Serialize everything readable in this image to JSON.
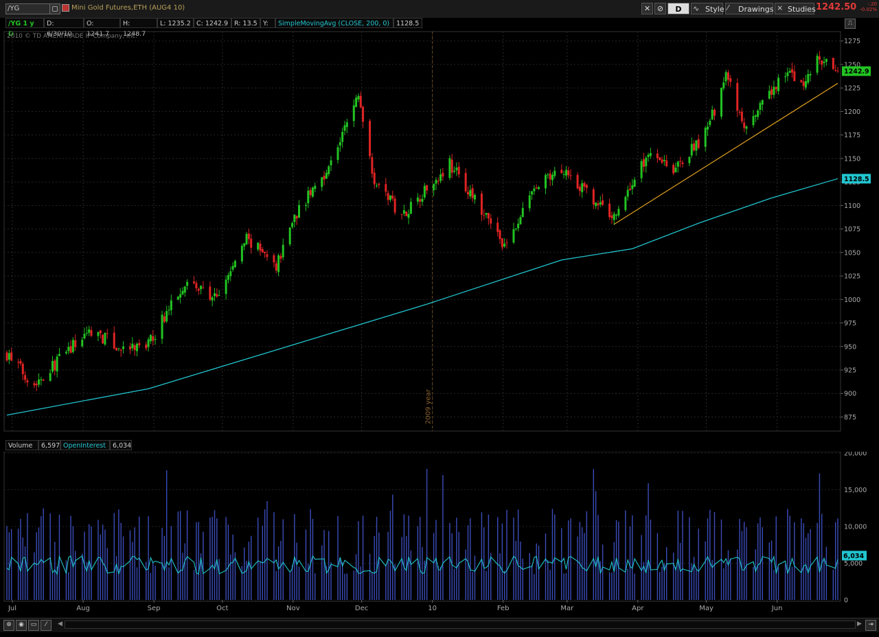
{
  "toolbar": {
    "symbol": "/YG",
    "description": "Mini Gold Futures,ETH (AUG4 10)",
    "timeframe_button": "D",
    "style_label": "Style",
    "drawings_label": "Drawings",
    "studies_label": "Studies",
    "last_price": "1242.50",
    "change": "-.20",
    "change_pct": "-0.02%"
  },
  "infobar": {
    "symbol_period": "/YG 1 y D",
    "date": "D: 6/30/10",
    "open": "O: 1241.7",
    "high": "H: 1248.7",
    "low": "L: 1235.2",
    "close": "C: 1242.9",
    "range": "R: 13.5",
    "y": "Y:",
    "study": "SimpleMovingAvg (CLOSE, 200, 0)",
    "study_value": "1128.5"
  },
  "copyright": "2010 © TD AMERITRADE IP Company, Inc.",
  "volume_bar": {
    "volume_label": "Volume",
    "volume_value": "6,597",
    "oi_label": "OpenInterest",
    "oi_value": "6,034"
  },
  "colors": {
    "up": "#22c322",
    "down": "#e02424",
    "sma": "#21c5cf",
    "trendline": "#e0a020",
    "volume": "#3b4dbb",
    "oi": "#21c5cf"
  },
  "chart_data": {
    "type": "candlestick",
    "x_range": [
      "2009-07-01",
      "2010-06-30"
    ],
    "x_ticks": [
      "Jul",
      "Aug",
      "Sep",
      "Oct",
      "Nov",
      "Dec",
      "10",
      "Feb",
      "Mar",
      "Apr",
      "May",
      "Jun"
    ],
    "year_marker": "2009 year",
    "ylim": [
      860,
      1285
    ],
    "y_ticks": [
      875,
      900,
      925,
      950,
      975,
      1000,
      1025,
      1050,
      1075,
      1100,
      1125,
      1150,
      1175,
      1200,
      1225,
      1250,
      1275
    ],
    "last_close": 1242.9,
    "sma_last": 1128.5,
    "price_path": [
      {
        "date": "2009-07-01",
        "close": 942
      },
      {
        "date": "2009-07-13",
        "close": 910
      },
      {
        "date": "2009-07-31",
        "close": 953
      },
      {
        "date": "2009-08-07",
        "close": 968
      },
      {
        "date": "2009-08-21",
        "close": 945
      },
      {
        "date": "2009-09-01",
        "close": 952
      },
      {
        "date": "2009-09-17",
        "close": 1020
      },
      {
        "date": "2009-10-01",
        "close": 1000
      },
      {
        "date": "2009-10-14",
        "close": 1065
      },
      {
        "date": "2009-10-27",
        "close": 1035
      },
      {
        "date": "2009-11-03",
        "close": 1085
      },
      {
        "date": "2009-11-20",
        "close": 1145
      },
      {
        "date": "2009-12-02",
        "close": 1218
      },
      {
        "date": "2009-12-09",
        "close": 1128
      },
      {
        "date": "2009-12-21",
        "close": 1090
      },
      {
        "date": "2010-01-11",
        "close": 1145
      },
      {
        "date": "2010-01-28",
        "close": 1083
      },
      {
        "date": "2010-02-05",
        "close": 1055
      },
      {
        "date": "2010-02-16",
        "close": 1115
      },
      {
        "date": "2010-03-02",
        "close": 1140
      },
      {
        "date": "2010-03-15",
        "close": 1105
      },
      {
        "date": "2010-03-24",
        "close": 1088
      },
      {
        "date": "2010-04-09",
        "close": 1160
      },
      {
        "date": "2010-04-20",
        "close": 1138
      },
      {
        "date": "2010-05-04",
        "close": 1180
      },
      {
        "date": "2010-05-12",
        "close": 1240
      },
      {
        "date": "2010-05-20",
        "close": 1180
      },
      {
        "date": "2010-06-01",
        "close": 1220
      },
      {
        "date": "2010-06-08",
        "close": 1245
      },
      {
        "date": "2010-06-14",
        "close": 1225
      },
      {
        "date": "2010-06-21",
        "close": 1255
      },
      {
        "date": "2010-06-30",
        "close": 1242.9
      }
    ],
    "sma_200": [
      {
        "date": "2009-07-01",
        "value": 877
      },
      {
        "date": "2009-09-01",
        "value": 905
      },
      {
        "date": "2009-11-01",
        "value": 950
      },
      {
        "date": "2010-01-01",
        "value": 995
      },
      {
        "date": "2010-03-01",
        "value": 1042
      },
      {
        "date": "2010-04-01",
        "value": 1054
      },
      {
        "date": "2010-05-01",
        "value": 1082
      },
      {
        "date": "2010-06-01",
        "value": 1108
      },
      {
        "date": "2010-06-30",
        "value": 1128.5
      }
    ],
    "trendline": [
      {
        "date": "2010-03-24",
        "value": 1080
      },
      {
        "date": "2010-06-30",
        "value": 1230
      }
    ],
    "volume_axis": {
      "ylim": [
        0,
        20000
      ],
      "ticks": [
        "0",
        "5,000",
        "10,000",
        "15,000",
        "20,000"
      ],
      "last_volume": 6597,
      "last_open_interest": 6034
    }
  }
}
